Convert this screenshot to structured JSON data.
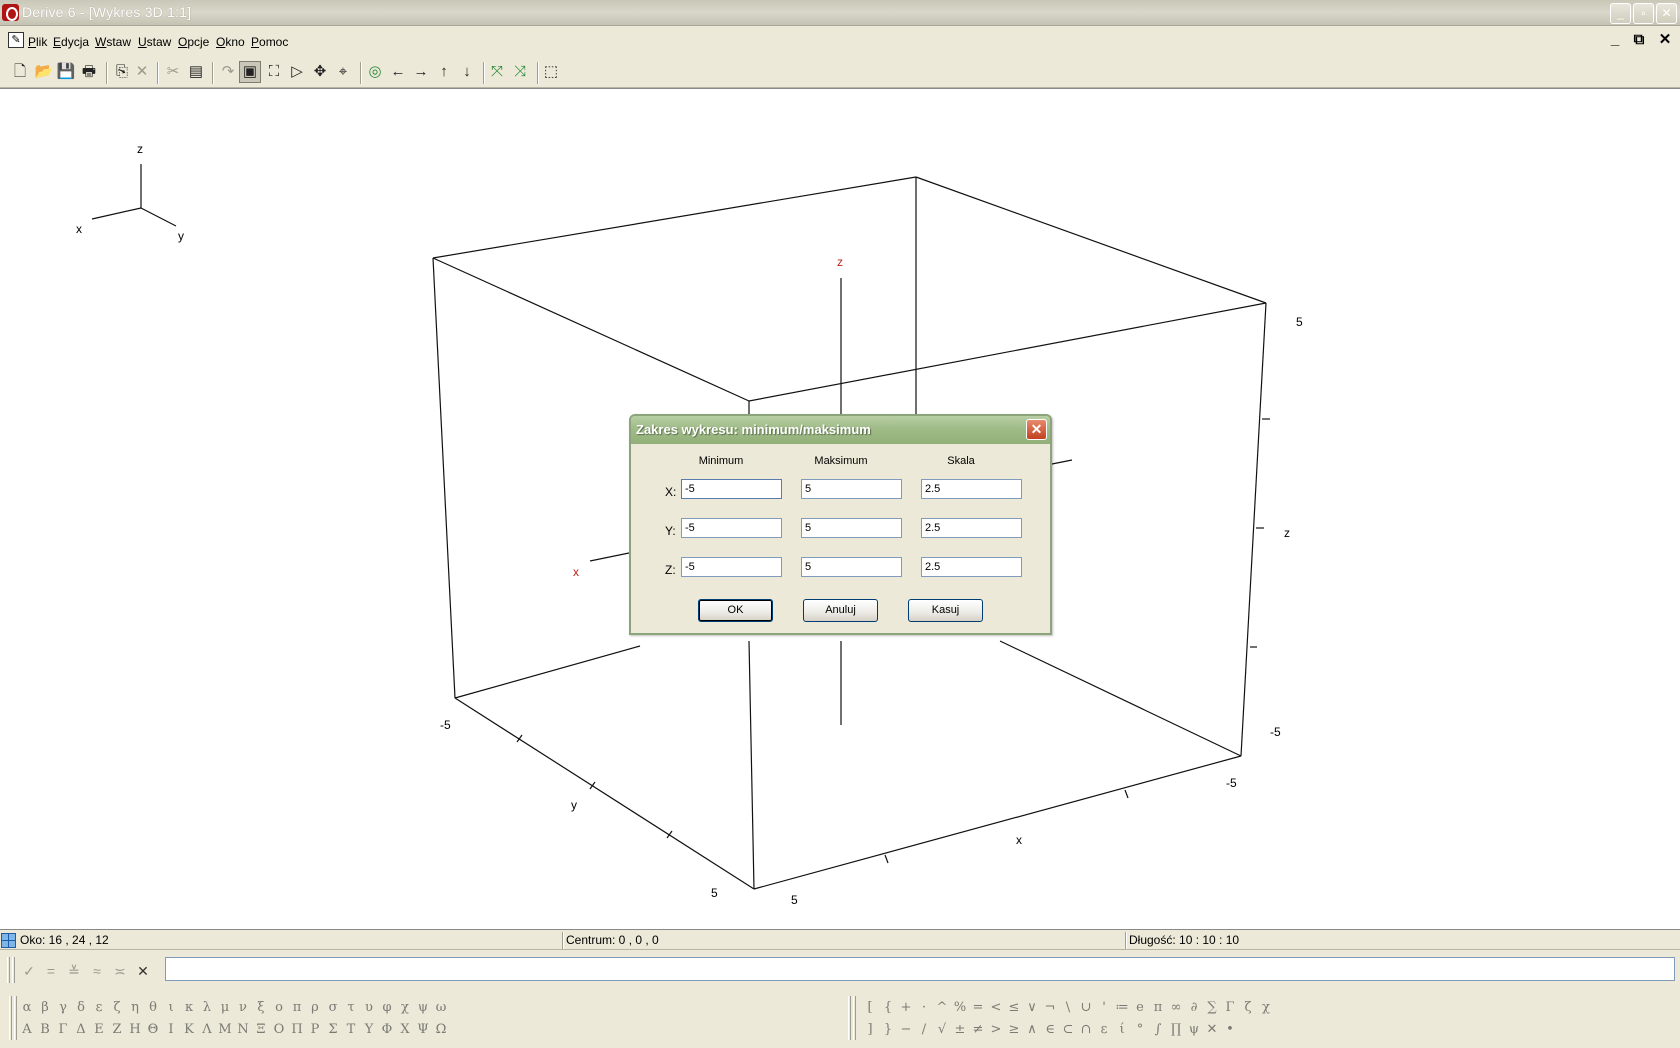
{
  "window": {
    "title": "Derive 6 - [Wykres 3D 1:1]"
  },
  "menu": [
    "Plik",
    "Edycja",
    "Wstaw",
    "Ustaw",
    "Opcje",
    "Okno",
    "Pomoc"
  ],
  "mdi_controls": {
    "minimize": "_",
    "restore": "⧉",
    "close": "✕"
  },
  "toolbar": {
    "buttons": [
      {
        "name": "new-icon",
        "glyph": "🗋"
      },
      {
        "name": "open-icon",
        "glyph": "📂"
      },
      {
        "name": "save-icon",
        "glyph": "💾"
      },
      {
        "name": "print-icon",
        "glyph": "🖶"
      },
      {
        "name": "copy-icon",
        "glyph": "⎘"
      },
      {
        "name": "delete-icon",
        "glyph": "✕"
      },
      {
        "name": "cut-icon",
        "glyph": "✂"
      },
      {
        "name": "insert-annotation-icon",
        "glyph": "▤"
      },
      {
        "name": "undo-icon",
        "glyph": "↷"
      },
      {
        "name": "plot-window-icon",
        "glyph": "▣"
      },
      {
        "name": "plot-region-icon",
        "glyph": "⛶"
      },
      {
        "name": "rotate-icon",
        "glyph": "▷"
      },
      {
        "name": "pan-icon",
        "glyph": "✥"
      },
      {
        "name": "center-icon",
        "glyph": "⌖"
      },
      {
        "name": "animate-icon",
        "glyph": "◎"
      },
      {
        "name": "arrow-left-icon",
        "glyph": "←"
      },
      {
        "name": "arrow-right-icon",
        "glyph": "→"
      },
      {
        "name": "arrow-up-icon",
        "glyph": "↑"
      },
      {
        "name": "arrow-down-icon",
        "glyph": "↓"
      },
      {
        "name": "zoom-in-icon",
        "glyph": "⤧"
      },
      {
        "name": "zoom-out-icon",
        "glyph": "⤨"
      },
      {
        "name": "select-area-icon",
        "glyph": "⬚"
      }
    ]
  },
  "axes_indicator": {
    "x": "x",
    "y": "y",
    "z": "z"
  },
  "plot": {
    "box_labels": {
      "x": "x",
      "y": "y",
      "z": "z"
    },
    "axis_labels": {
      "z_red": "z",
      "x_red": "x"
    },
    "tick_values": {
      "z_top": "5",
      "z_bottom": "-5",
      "y_min": "-5",
      "y_max": "5",
      "x_min": "-5",
      "x_max": "5"
    }
  },
  "dialog": {
    "title": "Zakres wykresu: minimum/maksimum",
    "close_glyph": "✕",
    "columns": [
      "Minimum",
      "Maksimum",
      "Skala"
    ],
    "rows": [
      {
        "label": "X:",
        "min": "-5",
        "max": "5",
        "scale": "2.5"
      },
      {
        "label": "Y:",
        "min": "-5",
        "max": "5",
        "scale": "2.5"
      },
      {
        "label": "Z:",
        "min": "-5",
        "max": "5",
        "scale": "2.5"
      }
    ],
    "buttons": {
      "ok": "OK",
      "cancel": "Anuluj",
      "reset": "Kasuj"
    }
  },
  "status": {
    "eye": "Oko: 16 , 24 , 12",
    "center": "Centrum: 0 , 0 , 0",
    "length": "Długość: 10 : 10 : 10"
  },
  "entry": {
    "buttons": [
      "✓",
      "=",
      "≚",
      "≈",
      "≍",
      "✕"
    ],
    "value": ""
  },
  "greek_lower": [
    "α",
    "β",
    "γ",
    "δ",
    "ε",
    "ζ",
    "η",
    "θ",
    "ι",
    "κ",
    "λ",
    "μ",
    "ν",
    "ξ",
    "ο",
    "π",
    "ρ",
    "σ",
    "τ",
    "υ",
    "φ",
    "χ",
    "ψ",
    "ω"
  ],
  "greek_upper": [
    "Α",
    "Β",
    "Γ",
    "Δ",
    "Ε",
    "Ζ",
    "Η",
    "Θ",
    "Ι",
    "Κ",
    "Λ",
    "Μ",
    "Ν",
    "Ξ",
    "Ο",
    "Π",
    "Ρ",
    "Σ",
    "Τ",
    "Υ",
    "Φ",
    "Χ",
    "Ψ",
    "Ω"
  ],
  "math_top": [
    "[",
    "{",
    "+",
    "·",
    "^",
    "%",
    "=",
    "<",
    "≤",
    "∨",
    "¬",
    "\\",
    "∪",
    "'",
    "≔",
    "e",
    "π",
    "∞",
    "∂",
    "∑",
    "Γ",
    "ζ",
    "χ"
  ],
  "math_bottom": [
    "]",
    "}",
    "−",
    "/",
    "√",
    "±",
    "≠",
    ">",
    "≥",
    "∧",
    "∈",
    "⊂",
    "∩",
    "ε",
    "ί",
    "°",
    "∫",
    "∏",
    "ψ",
    "✕",
    "•"
  ]
}
